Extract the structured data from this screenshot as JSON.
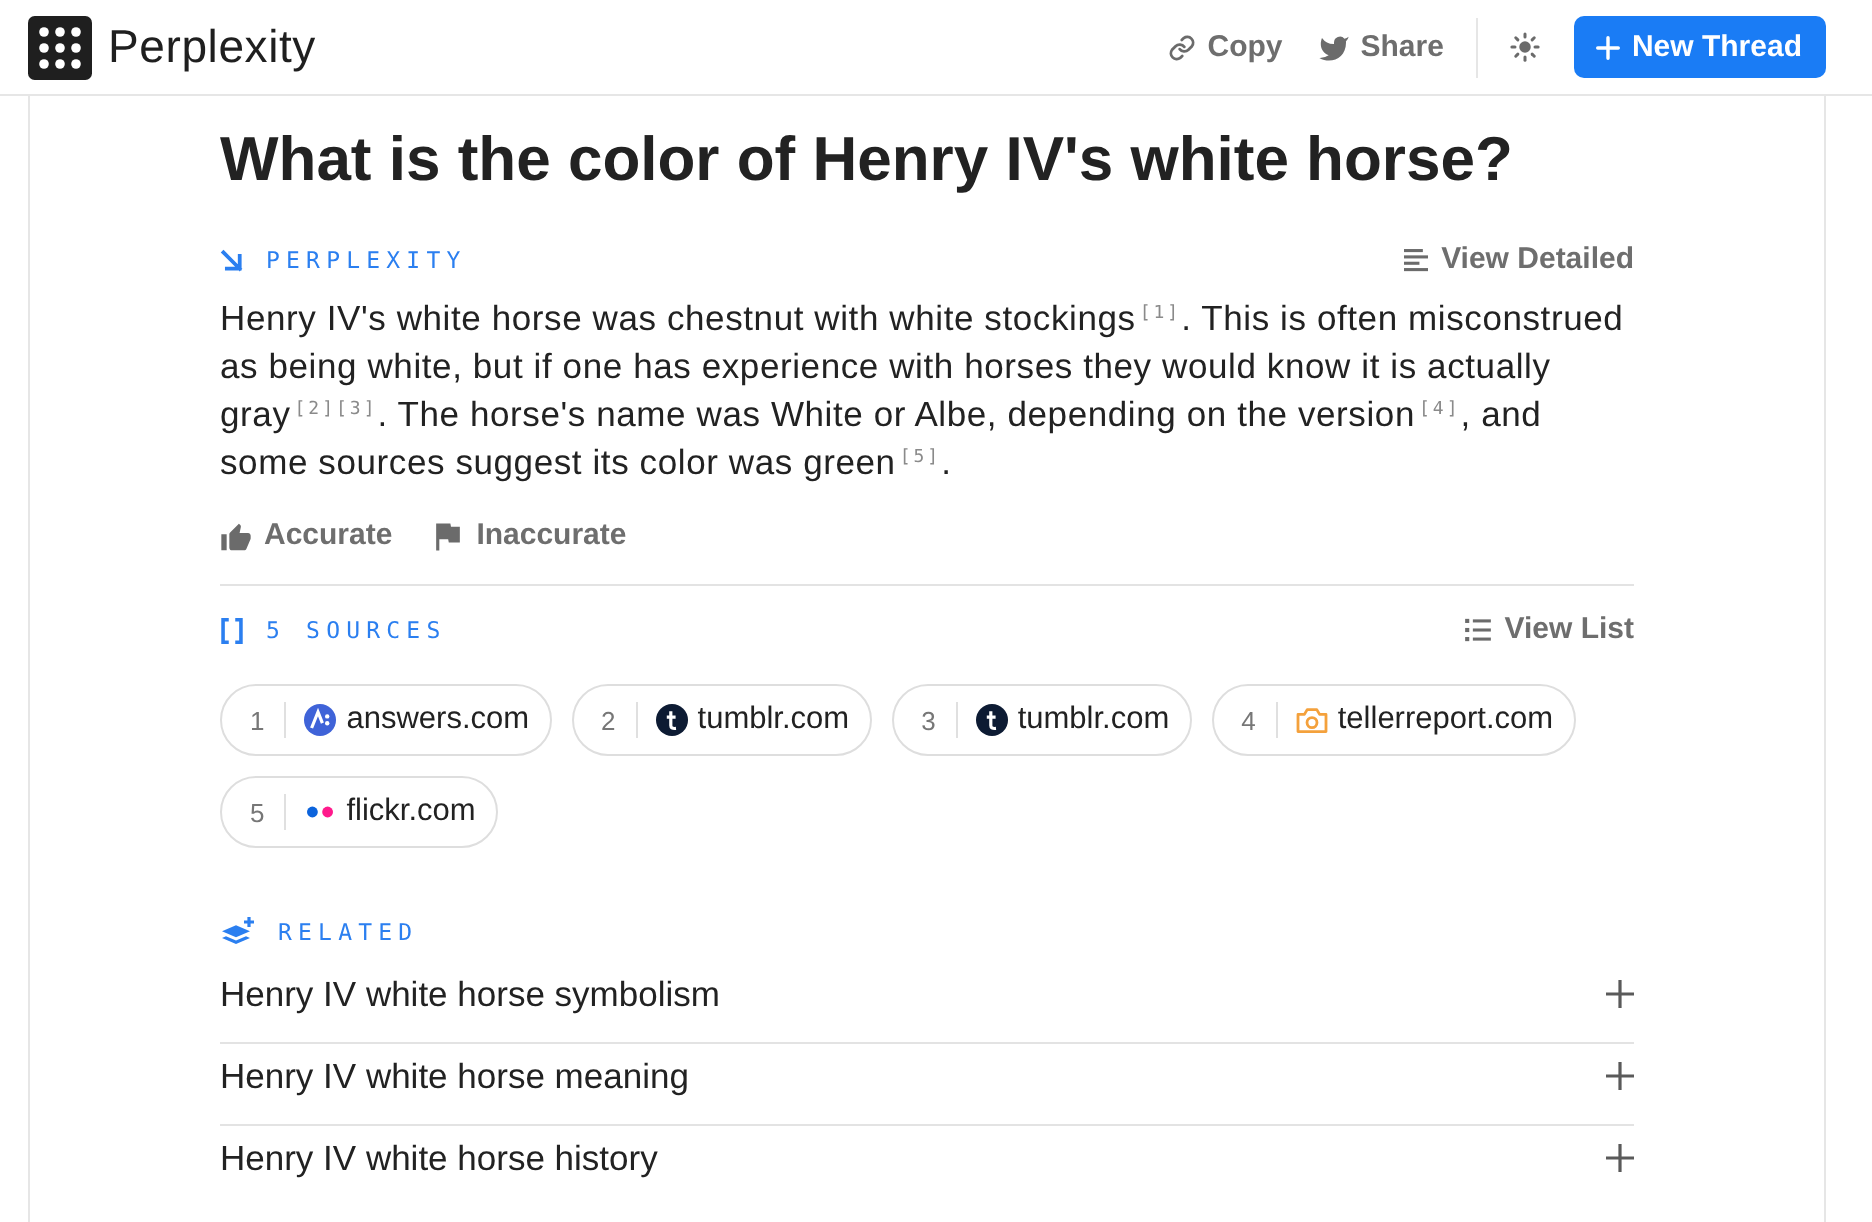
{
  "header": {
    "brand": "Perplexity",
    "actions": [
      {
        "label": "Copy",
        "kind": "copy"
      },
      {
        "label": "Share",
        "kind": "share"
      }
    ],
    "new_thread": "New Thread"
  },
  "question": "What is the color of Henry IV's white horse?",
  "answer": {
    "label": "PERPLEXITY",
    "view_detailed": "View Detailed",
    "text": "Henry IV's white horse was chestnut with white stockings$^{[1]}$. This is often misconstrued as being white, but if one has experience with horses they would know it is actually gray$^{[2][3]}$. The horse's name was White or Albe, depending on the version$^{[4]}$, and some sources suggest its color was green$^{[5]}$.",
    "feedback": [
      {
        "label": "Accurate",
        "kind": "thumb"
      },
      {
        "label": "Inaccurate",
        "kind": "flag"
      }
    ]
  },
  "sources": {
    "label": "5 SOURCES",
    "view_list": "View List",
    "items": [
      {
        "number": "1",
        "site": "answers.com",
        "kind": "badge"
      },
      {
        "number": "2",
        "site": "tumblr.com",
        "kind": "disc"
      },
      {
        "number": "3",
        "site": "tumblr.com",
        "kind": "disc"
      },
      {
        "number": "4",
        "site": "tellerreport.com",
        "kind": "camera"
      },
      {
        "number": "5",
        "site": "flickr.com",
        "kind": "dots"
      }
    ]
  },
  "related": {
    "label": "RELATED",
    "items": [
      "Henry IV white horse symbolism",
      "Henry IV white horse meaning",
      "Henry IV white horse history"
    ]
  }
}
